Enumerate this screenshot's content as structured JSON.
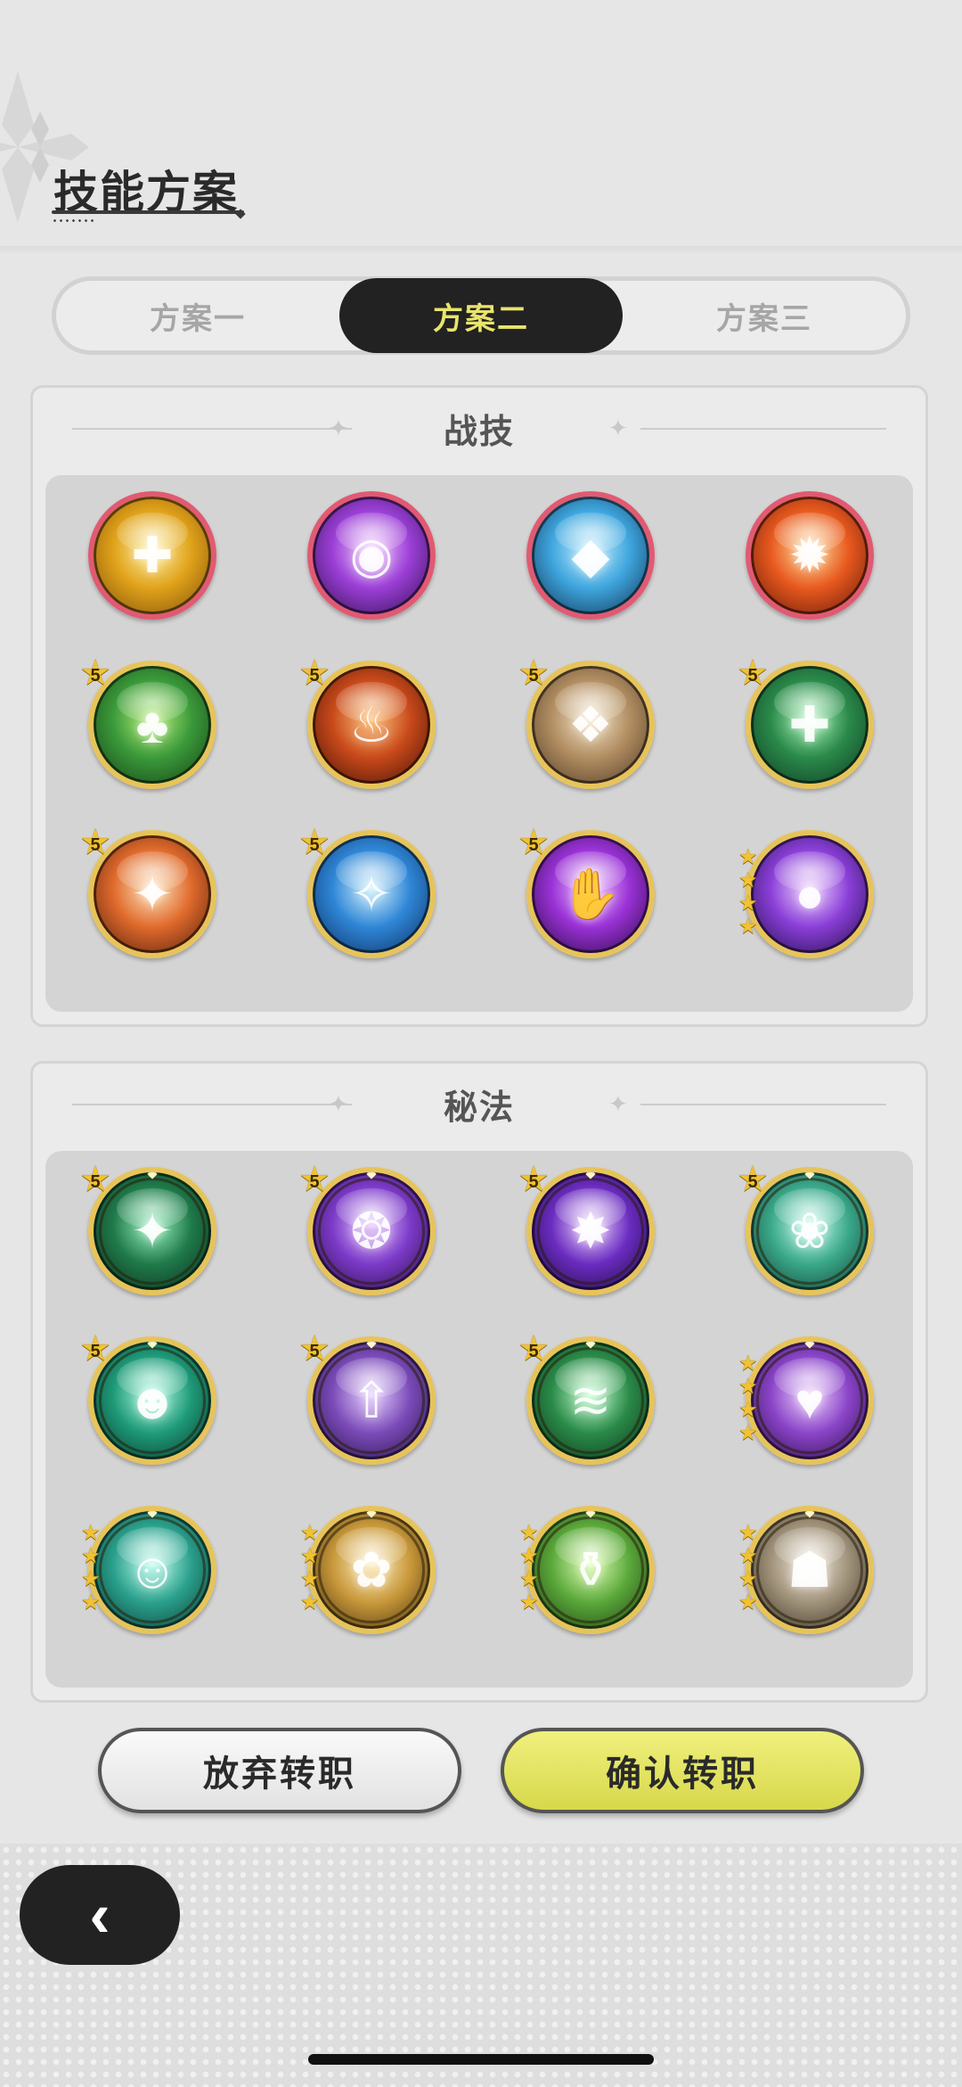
{
  "header": {
    "title": "技能方案"
  },
  "tabs": [
    {
      "label": "方案一",
      "active": false
    },
    {
      "label": "方案二",
      "active": true
    },
    {
      "label": "方案三",
      "active": false
    }
  ],
  "combat_section": {
    "title": "战技",
    "rows": [
      [
        {
          "name": "holy-light-skill-icon",
          "frame": "red",
          "colors": [
            "#fff2a8",
            "#e0a21a",
            "#7a4a08"
          ],
          "glyph": "✚",
          "badge": ""
        },
        {
          "name": "void-eye-skill-icon",
          "frame": "red",
          "colors": [
            "#f2c8ff",
            "#9b3fd6",
            "#2a0d45"
          ],
          "glyph": "◉",
          "badge": ""
        },
        {
          "name": "ice-crystal-skill-icon",
          "frame": "red",
          "colors": [
            "#c8f1ff",
            "#3fa6de",
            "#0c2a48"
          ],
          "glyph": "◆",
          "badge": ""
        },
        {
          "name": "fire-burst-skill-icon",
          "frame": "red",
          "colors": [
            "#ffe0a0",
            "#e8591e",
            "#5a1408"
          ],
          "glyph": "✹",
          "badge": ""
        }
      ],
      [
        {
          "name": "forest-totem-skill-icon",
          "frame": "gold",
          "colors": [
            "#b9f07a",
            "#3b9a3a",
            "#123a14"
          ],
          "glyph": "♣",
          "badge": "5"
        },
        {
          "name": "flame-vortex-skill-icon",
          "frame": "gold",
          "colors": [
            "#ffc37a",
            "#c8491a",
            "#3a0e06"
          ],
          "glyph": "♨",
          "badge": "5"
        },
        {
          "name": "ancient-scroll-skill-icon",
          "frame": "gold",
          "colors": [
            "#f4e6cc",
            "#b28e62",
            "#4a3622"
          ],
          "glyph": "❖",
          "badge": "5"
        },
        {
          "name": "healing-cross-skill-icon",
          "frame": "gold",
          "colors": [
            "#aaf5b8",
            "#2a8a4a",
            "#0c3320"
          ],
          "glyph": "✚",
          "badge": "5"
        }
      ],
      [
        {
          "name": "phoenix-roar-skill-icon",
          "frame": "gold",
          "colors": [
            "#ffe7c0",
            "#e06a2c",
            "#4a1a0a"
          ],
          "glyph": "✦",
          "badge": "5"
        },
        {
          "name": "frost-guardian-skill-icon",
          "frame": "gold",
          "colors": [
            "#d2f2ff",
            "#2f86d6",
            "#0a2a5c"
          ],
          "glyph": "✧",
          "badge": "5"
        },
        {
          "name": "shadow-hand-skill-icon",
          "frame": "gold",
          "colors": [
            "#f0c4ff",
            "#9a32d6",
            "#22063a"
          ],
          "glyph": "✋",
          "badge": "5"
        },
        {
          "name": "arcane-orb-skill-icon",
          "frame": "gold",
          "colors": [
            "#f2d6ff",
            "#8a3fd8",
            "#1c0a40"
          ],
          "glyph": "●",
          "badge": "stars"
        }
      ]
    ]
  },
  "arcana_section": {
    "title": "秘法",
    "rows": [
      [
        {
          "name": "emerald-spark-arcana-icon",
          "colors": [
            "#9af2c0",
            "#1f7a4a",
            "#0a2418"
          ],
          "glyph": "✦",
          "badge": "5"
        },
        {
          "name": "violet-swirl-arcana-icon",
          "colors": [
            "#e6c6ff",
            "#7c3ac8",
            "#210a3a"
          ],
          "glyph": "❂",
          "badge": "5"
        },
        {
          "name": "astral-star-arcana-icon",
          "colors": [
            "#f0d8ff",
            "#6a2cc0",
            "#160630"
          ],
          "glyph": "✸",
          "badge": "5"
        },
        {
          "name": "jade-leaf-arcana-icon",
          "colors": [
            "#c8fff0",
            "#3aa88a",
            "#0c3428"
          ],
          "glyph": "❀",
          "badge": "5"
        }
      ],
      [
        {
          "name": "spirit-aura-arcana-icon",
          "colors": [
            "#b6ffe6",
            "#1e9a78",
            "#072a22"
          ],
          "glyph": "☻",
          "badge": "5"
        },
        {
          "name": "rising-power-arcana-icon",
          "colors": [
            "#e8d2ff",
            "#7a4ab8",
            "#1e0e36"
          ],
          "glyph": "⇧",
          "badge": "5"
        },
        {
          "name": "green-rune-arcana-icon",
          "colors": [
            "#c2ffcf",
            "#2a8a48",
            "#0a2a16"
          ],
          "glyph": "≋",
          "badge": "5"
        },
        {
          "name": "heart-witch-arcana-icon",
          "colors": [
            "#f0d4ff",
            "#8a44c8",
            "#22083a"
          ],
          "glyph": "♥",
          "badge": "stars"
        }
      ],
      [
        {
          "name": "teal-vision-arcana-icon",
          "colors": [
            "#c6fff2",
            "#2aa08c",
            "#08302a"
          ],
          "glyph": "☺",
          "badge": "stars"
        },
        {
          "name": "golden-blessing-arcana-icon",
          "colors": [
            "#fff0c4",
            "#c8983a",
            "#3a280a"
          ],
          "glyph": "✿",
          "badge": "stars"
        },
        {
          "name": "potion-flask-arcana-icon",
          "colors": [
            "#e2ffb6",
            "#5aa83a",
            "#1a3210"
          ],
          "glyph": "⚱",
          "badge": "stars"
        },
        {
          "name": "stone-sage-arcana-icon",
          "colors": [
            "#f2eadc",
            "#a0927a",
            "#2e261a"
          ],
          "glyph": "☗",
          "badge": "stars"
        }
      ]
    ]
  },
  "actions": {
    "abandon_label": "放弃转职",
    "confirm_label": "确认转职"
  },
  "nav": {
    "back_icon": "chevron-left-icon"
  },
  "colors": {
    "background": "#e6e6e6",
    "active_tab_bg": "#222222",
    "active_tab_text": "#e8e46c",
    "confirm_button": "#dcdd52",
    "red_frame": "#e15a72",
    "gold_frame": "#e7c45a"
  }
}
